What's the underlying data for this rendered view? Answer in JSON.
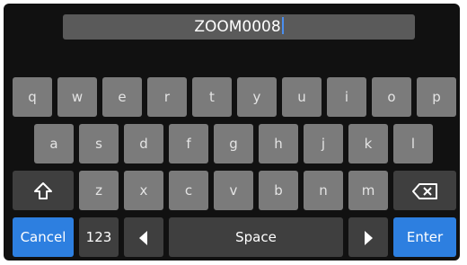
{
  "input": {
    "value": "ZOOM0008"
  },
  "keyboard": {
    "row1": [
      "q",
      "w",
      "e",
      "r",
      "t",
      "y",
      "u",
      "i",
      "o",
      "p"
    ],
    "row2": [
      "a",
      "s",
      "d",
      "f",
      "g",
      "h",
      "j",
      "k",
      "l"
    ],
    "row3": [
      "z",
      "x",
      "c",
      "v",
      "b",
      "n",
      "m"
    ],
    "cancel": "Cancel",
    "numbers": "123",
    "space": "Space",
    "enter": "Enter"
  },
  "colors": {
    "accent": "#2d7fe0",
    "key": "#7b7b7b",
    "key_dark": "#3f3f3f"
  },
  "icons": {
    "shift": "shift-icon",
    "backspace": "backspace-icon",
    "left": "left-arrow-icon",
    "right": "right-arrow-icon"
  }
}
